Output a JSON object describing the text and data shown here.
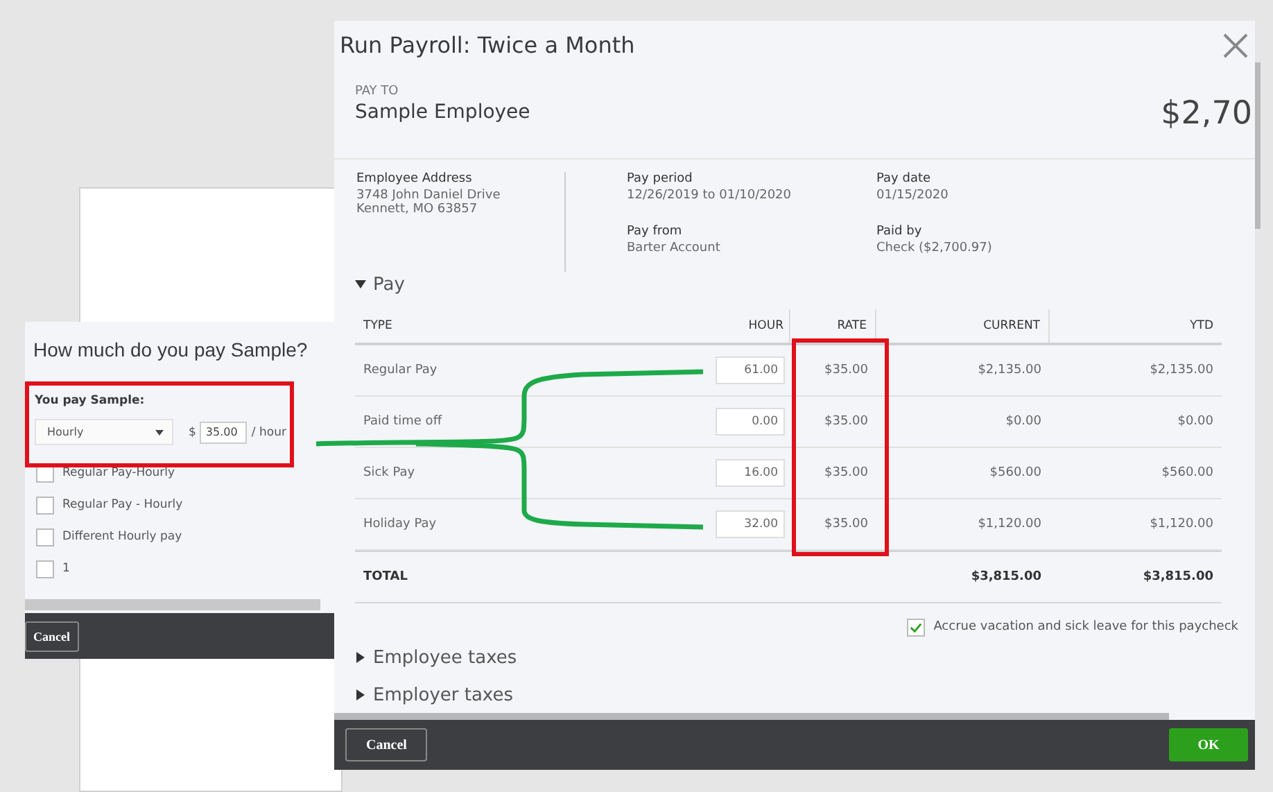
{
  "pay_rate_dialog": {
    "title": "How much do you pay Sample?",
    "pay_label": "You pay Sample:",
    "pay_type": "Hourly",
    "currency": "$",
    "rate": "35.00",
    "unit": "/ hour",
    "options": [
      {
        "label": "Regular Pay-Hourly",
        "checked": false
      },
      {
        "label": "Regular Pay - Hourly",
        "checked": false
      },
      {
        "label": "Different Hourly pay",
        "checked": false
      },
      {
        "label": "1",
        "checked": false
      }
    ],
    "buttons": [
      "Cancel"
    ]
  },
  "payroll_dialog": {
    "title": "Run Payroll: Twice a Month",
    "pay_to_label": "PAY TO",
    "employee": "Sample Employee",
    "amount": "$2,70",
    "address": {
      "label": "Employee Address",
      "lines": [
        "3748 John Daniel Drive",
        "Kennett, MO 63857"
      ]
    },
    "details": [
      {
        "label": "Pay period",
        "value": "12/26/2019 to 01/10/2020"
      },
      {
        "label": "Pay date",
        "value": "01/15/2020"
      },
      {
        "label": "Pay from",
        "value": "Barter Account"
      },
      {
        "label": "Paid by",
        "value": "Check ($2,700.97)"
      }
    ],
    "pay_section": {
      "title": "Pay",
      "expanded": true,
      "table": {
        "columns": [
          "TYPE",
          "HOUR",
          "RATE",
          "CURRENT",
          "YTD"
        ],
        "rows": [
          {
            "type": "Regular Pay",
            "hour": "61.00",
            "rate": "$35.00",
            "current": "$2,135.00",
            "ytd": "$2,135.00"
          },
          {
            "type": "Paid time off",
            "hour": "0.00",
            "rate": "$35.00",
            "current": "$0.00",
            "ytd": "$0.00"
          },
          {
            "type": "Sick Pay",
            "hour": "16.00",
            "rate": "$35.00",
            "current": "$560.00",
            "ytd": "$560.00"
          },
          {
            "type": "Holiday Pay",
            "hour": "32.00",
            "rate": "$35.00",
            "current": "$1,120.00",
            "ytd": "$1,120.00"
          }
        ],
        "total": {
          "label": "TOTAL",
          "current": "$3,815.00",
          "ytd": "$3,815.00"
        }
      }
    },
    "accrue": {
      "label": "Accrue vacation and sick leave for this paycheck",
      "checked": true
    },
    "sections": [
      {
        "title": "Employee taxes",
        "expanded": false
      },
      {
        "title": "Employer taxes",
        "expanded": false
      }
    ],
    "buttons": {
      "cancel": "Cancel",
      "ok": "OK"
    }
  }
}
